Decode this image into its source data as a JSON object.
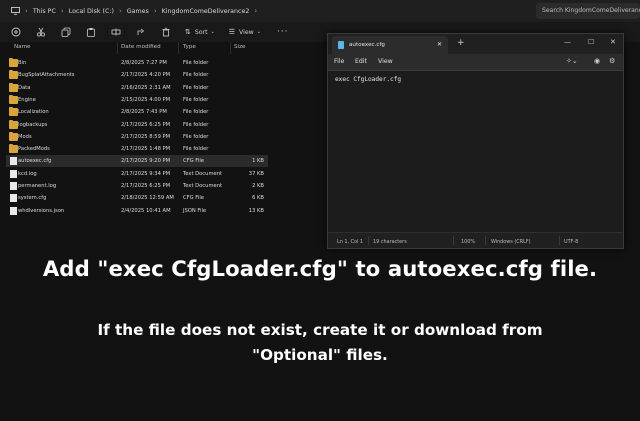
{
  "explorer": {
    "breadcrumbs": [
      "This PC",
      "Local Disk (C:)",
      "Games",
      "KingdomComeDeliverance2"
    ],
    "search_placeholder": "Search KingdomComeDeliverance2",
    "toolbar": {
      "sort_label": "Sort",
      "view_label": "View",
      "more_label": "···"
    },
    "columns": {
      "name": "Name",
      "date": "Date modified",
      "type": "Type",
      "size": "Size"
    },
    "rows": [
      {
        "name": "Bin",
        "date": "2/8/2025 7:27 PM",
        "type": "File folder",
        "size": "",
        "kind": "folder"
      },
      {
        "name": "BugSplatAttachments",
        "date": "2/17/2025 4:20 PM",
        "type": "File folder",
        "size": "",
        "kind": "folder"
      },
      {
        "name": "Data",
        "date": "2/16/2025 2:31 AM",
        "type": "File folder",
        "size": "",
        "kind": "folder"
      },
      {
        "name": "Engine",
        "date": "2/15/2025 4:00 PM",
        "type": "File folder",
        "size": "",
        "kind": "folder"
      },
      {
        "name": "Localization",
        "date": "2/8/2025 7:43 PM",
        "type": "File folder",
        "size": "",
        "kind": "folder"
      },
      {
        "name": "logbackups",
        "date": "2/17/2025 6:25 PM",
        "type": "File folder",
        "size": "",
        "kind": "folder"
      },
      {
        "name": "Mods",
        "date": "2/17/2025 8:59 PM",
        "type": "File folder",
        "size": "",
        "kind": "folder"
      },
      {
        "name": "PackedMods",
        "date": "2/17/2025 1:48 PM",
        "type": "File folder",
        "size": "",
        "kind": "folder"
      },
      {
        "name": "autoexec.cfg",
        "date": "2/17/2025 9:20 PM",
        "type": "CFG File",
        "size": "1 KB",
        "kind": "file"
      },
      {
        "name": "kcd.log",
        "date": "2/17/2025 9:34 PM",
        "type": "Text Document",
        "size": "37 KB",
        "kind": "file"
      },
      {
        "name": "permanent.log",
        "date": "2/17/2025 6:25 PM",
        "type": "Text Document",
        "size": "2 KB",
        "kind": "file"
      },
      {
        "name": "system.cfg",
        "date": "2/18/2025 12:59 AM",
        "type": "CFG File",
        "size": "6 KB",
        "kind": "file"
      },
      {
        "name": "whdlversions.json",
        "date": "2/4/2025 10:41 AM",
        "type": "JSON File",
        "size": "13 KB",
        "kind": "file"
      }
    ],
    "selected_row": "autoexec.cfg"
  },
  "notepad": {
    "tab_title": "autoexec.cfg",
    "menu": [
      "File",
      "Edit",
      "View"
    ],
    "content": "exec CfgLoader.cfg",
    "status": {
      "position": "Ln 1, Col 1",
      "chars": "19 characters",
      "zoom": "100%",
      "line_ending": "Windows (CRLF)",
      "encoding": "UTF-8"
    }
  },
  "instructions": {
    "main": "Add \"exec CfgLoader.cfg\" to autoexec.cfg file.",
    "sub_line1": "If the file does not exist, create it or download from",
    "sub_line2": "\"Optional\" files."
  },
  "colors": {
    "folder": "#d9a43b",
    "notepad_icon": "#5fb4e8",
    "background": "#0f0f0f"
  }
}
